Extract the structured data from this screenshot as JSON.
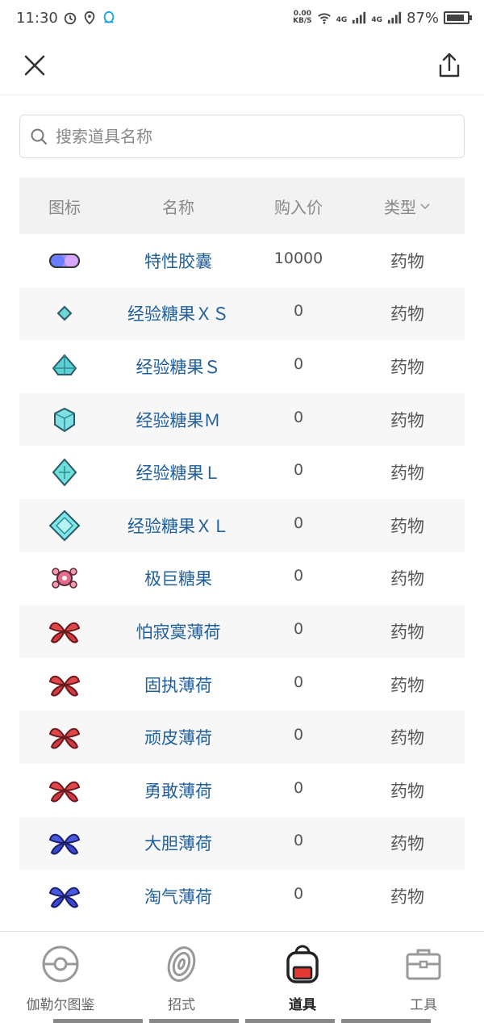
{
  "status_bar": {
    "time": "11:30",
    "net_speed_value": "0.00",
    "net_speed_unit": "KB/S",
    "signal_1": "4G",
    "signal_2": "4G",
    "battery": "87%",
    "battery_level": 0.87,
    "icons": [
      "alarm-icon",
      "location-icon",
      "qq-icon",
      "wifi-icon",
      "signal-icon",
      "battery-icon"
    ]
  },
  "header": {
    "close_icon": "close-icon",
    "share_icon": "share-icon"
  },
  "search": {
    "placeholder": "搜索道具名称"
  },
  "table": {
    "columns": [
      "图标",
      "名称",
      "购入价",
      "类型"
    ],
    "rows": [
      {
        "icon": "ability-capsule-icon",
        "name": "特性胶囊",
        "price": "10000",
        "type": "药物"
      },
      {
        "icon": "exp-candy-xs-icon",
        "name": "经验糖果ＸＳ",
        "price": "0",
        "type": "药物"
      },
      {
        "icon": "exp-candy-s-icon",
        "name": "经验糖果Ｓ",
        "price": "0",
        "type": "药物"
      },
      {
        "icon": "exp-candy-m-icon",
        "name": "经验糖果Ｍ",
        "price": "0",
        "type": "药物"
      },
      {
        "icon": "exp-candy-l-icon",
        "name": "经验糖果Ｌ",
        "price": "0",
        "type": "药物"
      },
      {
        "icon": "exp-candy-xl-icon",
        "name": "经验糖果ＸＬ",
        "price": "0",
        "type": "药物"
      },
      {
        "icon": "dynamax-candy-icon",
        "name": "极巨糖果",
        "price": "0",
        "type": "药物"
      },
      {
        "icon": "red-mint-icon",
        "name": "怕寂寞薄荷",
        "price": "0",
        "type": "药物"
      },
      {
        "icon": "red-mint-icon",
        "name": "固执薄荷",
        "price": "0",
        "type": "药物"
      },
      {
        "icon": "red-mint-icon",
        "name": "顽皮薄荷",
        "price": "0",
        "type": "药物"
      },
      {
        "icon": "red-mint-icon",
        "name": "勇敢薄荷",
        "price": "0",
        "type": "药物"
      },
      {
        "icon": "blue-mint-icon",
        "name": "大胆薄荷",
        "price": "0",
        "type": "药物"
      },
      {
        "icon": "blue-mint-icon",
        "name": "淘气薄荷",
        "price": "0",
        "type": "药物"
      }
    ]
  },
  "tabs": [
    {
      "label": "伽勒尔图鉴",
      "icon": "pokeball-icon",
      "active": false
    },
    {
      "label": "招式",
      "icon": "moves-icon",
      "active": false
    },
    {
      "label": "道具",
      "icon": "bag-icon",
      "active": true
    },
    {
      "label": "工具",
      "icon": "toolbox-icon",
      "active": false
    }
  ],
  "colors": {
    "link": "#1f5f9c",
    "header_bg": "#f2f2f2",
    "row_alt_bg": "#f7f7f7",
    "bag_accent": "#e53935"
  }
}
